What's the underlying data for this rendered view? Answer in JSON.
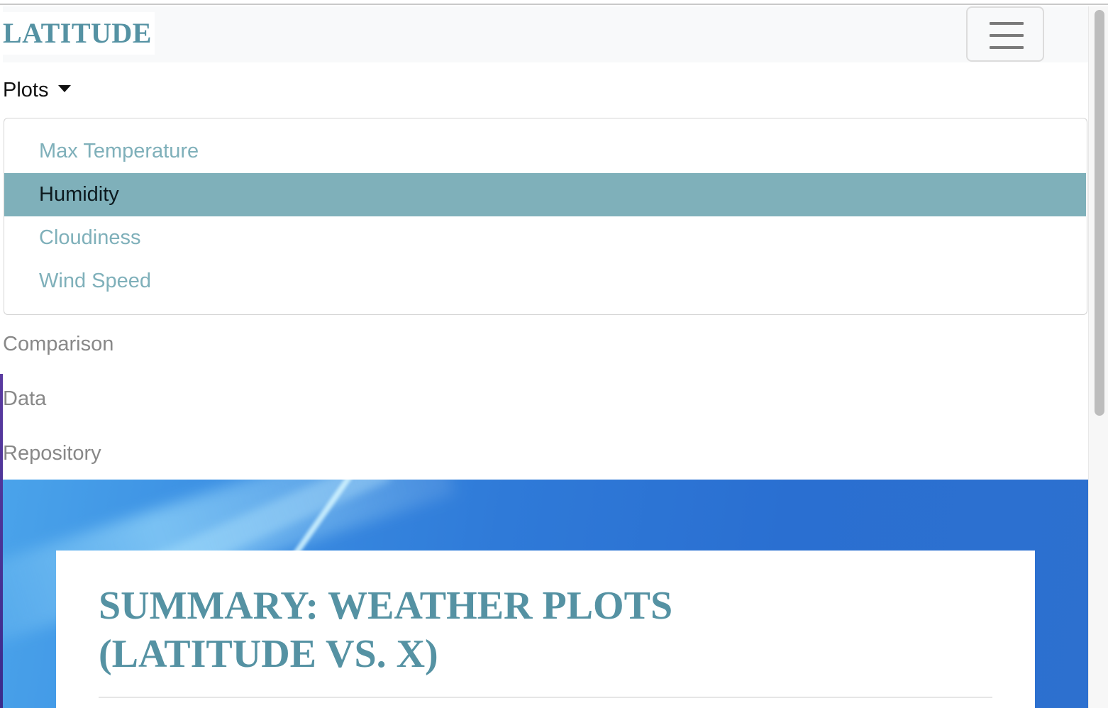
{
  "navbar": {
    "brand": "LATITUDE",
    "toggler_icon": "hamburger-icon"
  },
  "menu": {
    "plots_label": "Plots",
    "plots_caret_icon": "caret-down-icon",
    "dropdown_items": [
      {
        "label": "Max Temperature",
        "active": false
      },
      {
        "label": "Humidity",
        "active": true
      },
      {
        "label": "Cloudiness",
        "active": false
      },
      {
        "label": "Wind Speed",
        "active": false
      }
    ],
    "links": [
      "Comparison",
      "Data",
      "Repository"
    ]
  },
  "summary": {
    "title_line1": "SUMMARY: WEATHER PLOTS",
    "title_line2": "(LATITUDE VS. X)"
  },
  "colors": {
    "brand": "#5592a3",
    "dropdown_link": "#7fb0ba",
    "active_bg": "#7fb0ba",
    "navbar_bg": "#f8f9fa"
  }
}
